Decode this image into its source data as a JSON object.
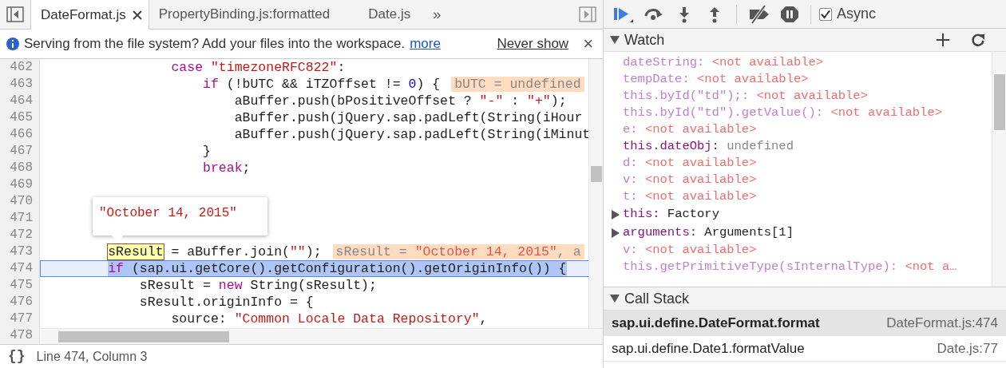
{
  "editor": {
    "tabs": [
      {
        "label": "DateFormat.js",
        "selected": true,
        "closable": true
      },
      {
        "label": "PropertyBinding.js:formatted",
        "selected": false,
        "closable": false
      },
      {
        "label": "Date.js",
        "selected": false,
        "closable": false
      }
    ],
    "tabs_overflow": "»",
    "infobar": {
      "message": "Serving from the file system? Add your files into the workspace.",
      "link": "more",
      "dismiss": "Never show",
      "close": "×"
    },
    "lines": [
      {
        "number": "462",
        "current": false,
        "segments": [
          {
            "kind": "kw",
            "text": "                case"
          },
          {
            "kind": "str",
            "text": " \"timezoneRFC822\""
          },
          {
            "kind": "text",
            "text": ":"
          }
        ]
      },
      {
        "number": "463",
        "current": false,
        "segments": [
          {
            "kind": "kw",
            "text": "                    if"
          },
          {
            "kind": "text",
            "text": " (!bUTC && iTZOffset != "
          },
          {
            "kind": "num",
            "text": "0"
          },
          {
            "kind": "text",
            "text": ") {"
          }
        ],
        "inline_value": [
          {
            "kind": "text",
            "text": "bUTC = undefined"
          }
        ]
      },
      {
        "number": "464",
        "current": false,
        "segments": [
          {
            "kind": "text",
            "text": "                        aBuffer.push(bPositiveOffset ? "
          },
          {
            "kind": "str",
            "text": "\"-\""
          },
          {
            "kind": "text",
            "text": " : "
          },
          {
            "kind": "str",
            "text": "\"+\""
          },
          {
            "kind": "text",
            "text": ");"
          }
        ]
      },
      {
        "number": "465",
        "current": false,
        "segments": [
          {
            "kind": "text",
            "text": "                        aBuffer.push(jQuery.sap.padLeft(String(iHour"
          }
        ]
      },
      {
        "number": "466",
        "current": false,
        "segments": [
          {
            "kind": "text",
            "text": "                        aBuffer.push(jQuery.sap.padLeft(String(iMinut"
          }
        ]
      },
      {
        "number": "467",
        "current": false,
        "segments": [
          {
            "kind": "text",
            "text": "                    }"
          }
        ]
      },
      {
        "number": "468",
        "current": false,
        "segments": [
          {
            "kind": "kw",
            "text": "                    break"
          },
          {
            "kind": "text",
            "text": ";"
          }
        ]
      },
      {
        "number": "469",
        "current": false
      },
      {
        "number": "470",
        "current": false
      },
      {
        "number": "471",
        "current": false
      },
      {
        "number": "472",
        "current": false
      },
      {
        "number": "473",
        "current": false,
        "segments": [
          {
            "kind": "hover",
            "text": "        sResult"
          },
          {
            "kind": "text",
            "text": " = aBuffer.join("
          },
          {
            "kind": "str",
            "text": "\"\""
          },
          {
            "kind": "text",
            "text": ");"
          }
        ],
        "inline_value": [
          {
            "kind": "text",
            "text": "sResult = "
          },
          {
            "kind": "str",
            "text": "\"October 14, 2015\""
          },
          {
            "kind": "text",
            "text": ", a"
          }
        ]
      },
      {
        "number": "474",
        "current": true,
        "segments": [
          {
            "kind": "kw",
            "text": "        if"
          },
          {
            "kind": "text",
            "text": " (sap.ui.getCore().getConfiguration().getOriginInfo()) {"
          }
        ]
      },
      {
        "number": "475",
        "current": false,
        "segments": [
          {
            "kind": "text",
            "text": "            sResult = "
          },
          {
            "kind": "kw",
            "text": "new"
          },
          {
            "kind": "text",
            "text": " String(sResult);"
          }
        ]
      },
      {
        "number": "476",
        "current": false,
        "segments": [
          {
            "kind": "text",
            "text": "            sResult.originInfo = {"
          }
        ]
      },
      {
        "number": "477",
        "current": false,
        "segments": [
          {
            "kind": "text",
            "text": "                source: "
          },
          {
            "kind": "str",
            "text": "\"Common Locale Data Repository\""
          },
          {
            "kind": "text",
            "text": ","
          }
        ]
      },
      {
        "number": "478",
        "current": false
      }
    ],
    "popover": {
      "value": "\"October 14, 2015\""
    },
    "status": {
      "icon": "{}",
      "position": "Line 474, Column 3"
    }
  },
  "debugger": {
    "async": {
      "label": "Async",
      "checked": true
    },
    "watch": {
      "title": "Watch",
      "expanded": true,
      "items": [
        {
          "name": "dateString:",
          "value": "<not available>",
          "kind": "unavailable",
          "expandable": false
        },
        {
          "name": "tempDate:",
          "value": "<not available>",
          "kind": "unavailable",
          "expandable": false
        },
        {
          "name": "this.byId(\"td\");:",
          "value": "<not available>",
          "kind": "unavailable",
          "expandable": false
        },
        {
          "name": "this.byId(\"td\").getValue():",
          "value": "<not available>",
          "kind": "unavailable",
          "expandable": false
        },
        {
          "name": "e:",
          "value": "<not available>",
          "kind": "unavailable",
          "expandable": false
        },
        {
          "name": "this.dateObj:",
          "value": "undefined",
          "kind": "undefined",
          "expandable": false
        },
        {
          "name": "d:",
          "value": "<not available>",
          "kind": "unavailable",
          "expandable": false
        },
        {
          "name": "v:",
          "value": "<not available>",
          "kind": "unavailable",
          "expandable": false
        },
        {
          "name": "t:",
          "value": "<not available>",
          "kind": "unavailable",
          "expandable": false
        },
        {
          "name": "this:",
          "value": "Factory",
          "kind": "object",
          "expandable": true
        },
        {
          "name": "arguments:",
          "value": "Arguments[1]",
          "kind": "object",
          "expandable": true
        },
        {
          "name": "v:",
          "value": "<not available>",
          "kind": "unavailable",
          "expandable": false
        },
        {
          "name": "this.getPrimitiveType(sInternalType):",
          "value": "<not a…",
          "kind": "unavailable",
          "expandable": false
        }
      ]
    },
    "call_stack": {
      "title": "Call Stack",
      "expanded": true,
      "frames": [
        {
          "function": "sap.ui.define.DateFormat.format",
          "location": "DateFormat.js:474",
          "selected": true
        },
        {
          "function": "sap.ui.define.Date1.formatValue",
          "location": "Date.js:77",
          "selected": false
        }
      ]
    }
  }
}
